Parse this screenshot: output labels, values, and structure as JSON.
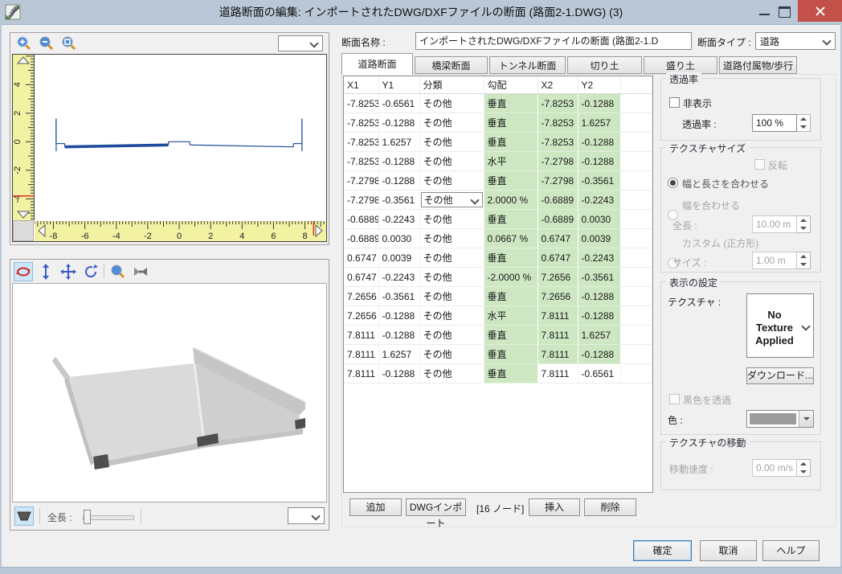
{
  "window": {
    "title": "道路断面の編集: インポートされたDWG/DXFファイルの断面 (路面2-1.DWG) (3)"
  },
  "icons": {
    "app": "road-app-icon",
    "zoom_in": "zoom-in-icon",
    "zoom_out": "zoom-out-icon",
    "zoom_extents": "zoom-extents-icon",
    "orbit": "orbit-rotate-icon",
    "tilt": "tilt-view-icon",
    "pan": "pan-view-icon",
    "rotate_view": "rotate-view-icon",
    "view_frustum": "view-frustum-icon",
    "road_section": "road-section-icon"
  },
  "header": {
    "name_label": "断面名称 :",
    "name_value": "インポートされたDWG/DXFファイルの断面 (路面2-1.D",
    "type_label": "断面タイプ :",
    "type_value": "道路"
  },
  "tabs": [
    {
      "label": "道路断面"
    },
    {
      "label": "橋梁断面"
    },
    {
      "label": "トンネル断面"
    },
    {
      "label": "切り土"
    },
    {
      "label": "盛り土"
    },
    {
      "label": "道路付属物/歩行"
    }
  ],
  "table": {
    "columns": [
      "X1",
      "Y1",
      "分類",
      "勾配",
      "X2",
      "Y2"
    ],
    "rows": [
      [
        "-7.8253",
        "-0.6561",
        "その他",
        "垂直",
        "-7.8253",
        "-0.1288"
      ],
      [
        "-7.8253",
        "-0.1288",
        "その他",
        "垂直",
        "-7.8253",
        "1.6257"
      ],
      [
        "-7.8253",
        "1.6257",
        "その他",
        "垂直",
        "-7.8253",
        "-0.1288"
      ],
      [
        "-7.8253",
        "-0.1288",
        "その他",
        "水平",
        "-7.2798",
        "-0.1288"
      ],
      [
        "-7.2798",
        "-0.1288",
        "その他",
        "垂直",
        "-7.2798",
        "-0.3561"
      ],
      [
        "-7.2798",
        "-0.3561",
        "その他",
        "2.0000 %",
        "-0.6889",
        "-0.2243"
      ],
      [
        "-0.6889",
        "-0.2243",
        "その他",
        "垂直",
        "-0.6889",
        "0.0030"
      ],
      [
        "-0.6889",
        "0.0030",
        "その他",
        "0.0667 %",
        "0.6747",
        "0.0039"
      ],
      [
        "0.6747",
        "0.0039",
        "その他",
        "垂直",
        "0.6747",
        "-0.2243"
      ],
      [
        "0.6747",
        "-0.2243",
        "その他",
        "-2.0000 %",
        "7.2656",
        "-0.3561"
      ],
      [
        "7.2656",
        "-0.3561",
        "その他",
        "垂直",
        "7.2656",
        "-0.1288"
      ],
      [
        "7.2656",
        "-0.1288",
        "その他",
        "水平",
        "7.8111",
        "-0.1288"
      ],
      [
        "7.8111",
        "-0.1288",
        "その他",
        "垂直",
        "7.8111",
        "1.6257"
      ],
      [
        "7.8111",
        "1.6257",
        "その他",
        "垂直",
        "7.8111",
        "-0.1288"
      ],
      [
        "7.8111",
        "-0.1288",
        "その他",
        "垂直",
        "7.8111",
        "-0.6561"
      ]
    ],
    "combo_row_index": 5,
    "node_count_label": "[16 ノード]"
  },
  "table_buttons": {
    "add": "追加",
    "dwg_import": "DWGインポート",
    "insert": "挿入",
    "delete": "削除"
  },
  "panels": {
    "transparency": {
      "title": "透過率",
      "hide_checkbox": "非表示",
      "rate_label": "透過率 :",
      "rate_value": "100 %"
    },
    "texture_size": {
      "title": "テクスチャサイズ",
      "flip_checkbox": "反転",
      "fit_both": "幅と長さを合わせる",
      "fit_width": "幅を合わせる",
      "length_label": "全長 :",
      "length_value": "10.00 m",
      "custom": "カスタム (正方形)",
      "size_label": "サイズ :",
      "size_value": "1.00 m"
    },
    "display": {
      "title": "表示の設定",
      "texture_label": "テクスチャ :",
      "texture_value": "No Texture Applied",
      "download_button": "ダウンロード...",
      "black_checkbox": "黒色を透過",
      "color_label": "色 :"
    },
    "texture_move": {
      "title": "テクスチャの移動",
      "speed_label": "移動速度 :",
      "speed_value": "0.00 m/s"
    }
  },
  "viewer3d": {
    "length_label": "全長 :"
  },
  "footer": {
    "ok": "確定",
    "cancel": "取消",
    "help": "ヘルプ"
  },
  "profile": {
    "xmin": -9.2,
    "xmax": 9.35,
    "ymin": -5.5,
    "ymax": 6.1,
    "xticks": [
      -8,
      -6,
      -4,
      -2,
      0,
      2,
      4,
      6,
      8
    ],
    "yticks": [
      4,
      2,
      0,
      -2,
      -4
    ],
    "x_marker": 8.55,
    "y_marker": -3.8,
    "selected_segment": 5,
    "line_color": "#1f4d9e"
  },
  "colors": {
    "titlebar": "#b9c7d6",
    "close_button": "#c4504a",
    "table_highlight": "#cde7c2",
    "ruler": "#f3f1a2",
    "profile_line": "#1f4d9e"
  }
}
